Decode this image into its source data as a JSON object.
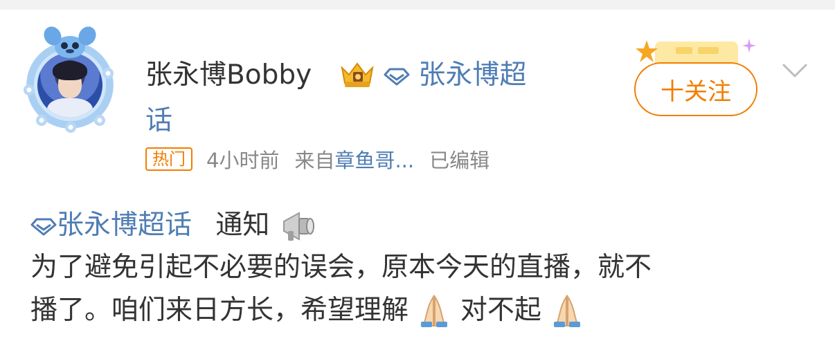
{
  "post": {
    "author_name": "张永博Bobby",
    "topic_label_part1": "张永博超",
    "topic_label_part2": "话",
    "hot_badge": "热门",
    "time": "4小时前",
    "source_prefix": "来自",
    "source_name": "章鱼哥...",
    "edited": "已编辑",
    "follow_label": "十关注",
    "content_topic": "张永博超话",
    "content_notice": "通知",
    "content_line1": "为了避免引起不必要的误会，原本今天的直播，就不",
    "content_line2a": "播了。咱们来日方长，希望理解",
    "content_line2b": "对不起"
  },
  "colors": {
    "link_blue": "#4f7db3",
    "orange": "#f27d00",
    "text": "#333333",
    "meta_gray": "#888888"
  },
  "icons": [
    "avatar-frame",
    "crown-icon",
    "diamond-topic-icon",
    "megaphone-icon",
    "folded-hands-emoji",
    "chevron-down-icon"
  ]
}
